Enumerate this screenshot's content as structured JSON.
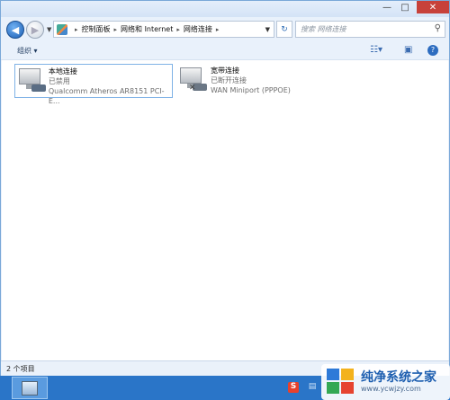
{
  "window": {
    "controls": {
      "minimize": "—",
      "maximize": "□",
      "close": "✕"
    }
  },
  "address": {
    "breadcrumb": [
      "控制面板",
      "网络和 Internet",
      "网络连接"
    ],
    "search_placeholder": "搜索 网络连接"
  },
  "toolbar": {
    "organize_label": "组织 ▾",
    "view_icon": "view-options-icon",
    "pane_icon": "preview-pane-icon",
    "help_label": "?"
  },
  "connections": [
    {
      "name": "本地连接",
      "status": "已禁用",
      "device": "Qualcomm Atheros AR8151 PCI-E...",
      "icon": "ethernet-adapter-icon"
    },
    {
      "name": "宽带连接",
      "status": "已断开连接",
      "device": "WAN Miniport (PPPOE)",
      "icon": "broadband-connection-icon"
    }
  ],
  "statusbar": {
    "item_count": "2 个项目"
  },
  "taskbar": {
    "tray_sogou": "S"
  },
  "watermark": {
    "title": "纯净系统之家",
    "url": "www.ycwjzy.com"
  },
  "colors": {
    "taskbar": "#2a75c8",
    "close_button": "#c7413a",
    "selection_border": "#7fb2e6"
  }
}
